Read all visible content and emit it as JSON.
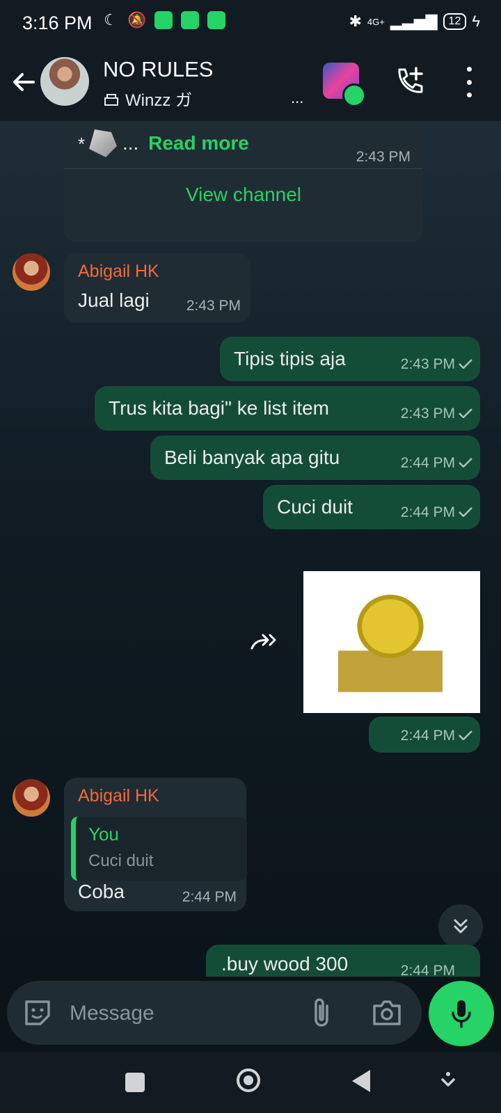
{
  "status_bar": {
    "time": "3:16 PM",
    "network": "4G+",
    "battery": "12"
  },
  "header": {
    "title": "NO RULES",
    "subtitle": "Winzz ガ",
    "ellipsis": "..."
  },
  "channel_card": {
    "prefix": "*",
    "ellipsis": "...",
    "read_more": "Read more",
    "time": "2:43 PM",
    "view_channel": "View channel"
  },
  "messages": [
    {
      "sender": "Abigail HK",
      "text": "Jual lagi",
      "time": "2:43 PM"
    },
    {
      "text": "Tipis tipis aja",
      "time": "2:43 PM"
    },
    {
      "text": "Trus kita bagi\" ke list item",
      "time": "2:43 PM"
    },
    {
      "text": "Beli banyak apa gitu",
      "time": "2:44 PM"
    },
    {
      "text": "Cuci duit",
      "time": "2:44 PM"
    },
    {
      "time": "2:44 PM"
    },
    {
      "sender": "Abigail HK",
      "quote_name": "You",
      "quote_text": "Cuci duit",
      "text": "Coba",
      "time": "2:44 PM"
    },
    {
      "text": ".buy wood 300",
      "time": "2:44 PM"
    }
  ],
  "composer": {
    "placeholder": "Message"
  },
  "icons": {
    "back": "arrow-left-icon",
    "call_add": "phone-plus-icon",
    "menu": "more-vertical-icon",
    "emoji": "sticker-icon",
    "attach": "paperclip-icon",
    "camera": "camera-icon",
    "mic": "mic-icon",
    "forward": "forward-icon",
    "scroll": "double-chevron-down-icon"
  },
  "colors": {
    "accent": "#25d366",
    "outgoing_bubble": "#144d37",
    "incoming_bubble": "#202c33",
    "sender_name": "#f3693a"
  }
}
